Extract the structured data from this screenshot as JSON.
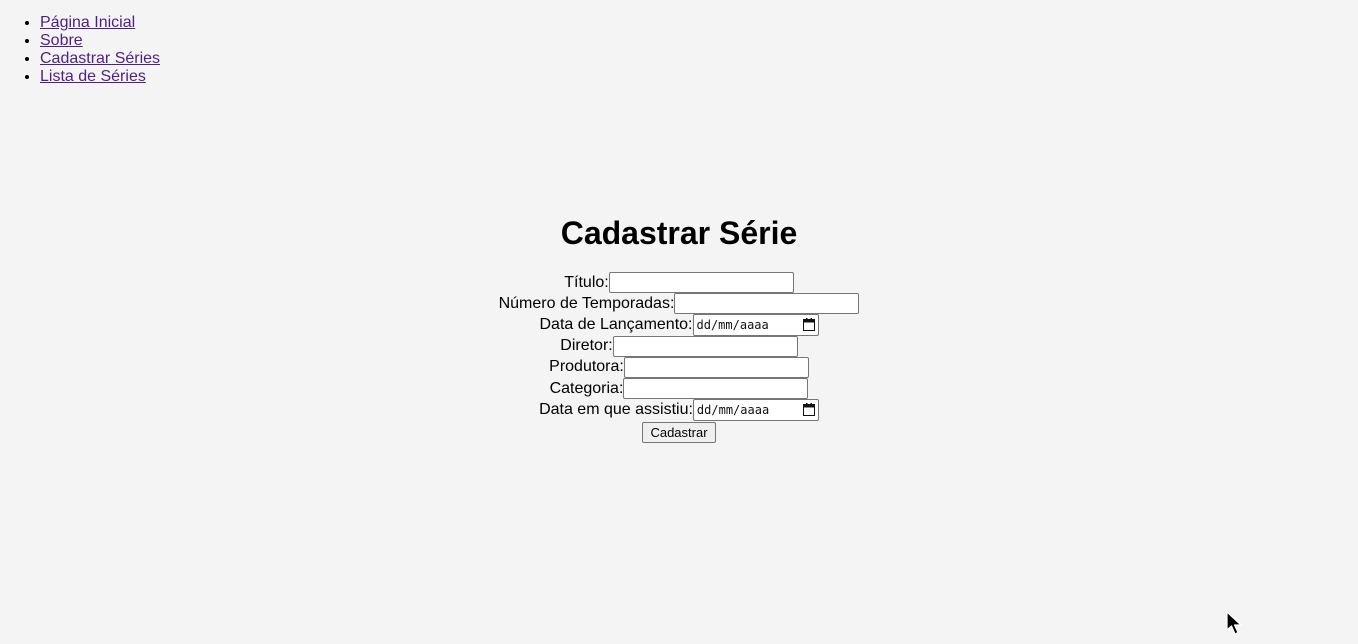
{
  "nav": {
    "items": [
      {
        "label": "Página Inicial"
      },
      {
        "label": "Sobre"
      },
      {
        "label": "Cadastrar Séries"
      },
      {
        "label": "Lista de Séries"
      }
    ]
  },
  "page_title": "Cadastrar Série",
  "form": {
    "fields": [
      {
        "label": "Título:",
        "type": "text",
        "value": ""
      },
      {
        "label": "Número de Temporadas:",
        "type": "text",
        "value": ""
      },
      {
        "label": "Data de Lançamento:",
        "type": "date",
        "placeholder": "dd/mm/aaaa"
      },
      {
        "label": "Diretor:",
        "type": "text",
        "value": ""
      },
      {
        "label": "Produtora:",
        "type": "text",
        "value": ""
      },
      {
        "label": "Categoria:",
        "type": "text",
        "value": ""
      },
      {
        "label": "Data em que assistiu:",
        "type": "date",
        "placeholder": "dd/mm/aaaa"
      }
    ],
    "submit_label": "Cadastrar"
  },
  "icons": {
    "calendar": "calendar-icon",
    "cursor": "mouse-pointer-icon"
  },
  "colors": {
    "background": "#f4f4f4",
    "link": "#4f1f86"
  }
}
